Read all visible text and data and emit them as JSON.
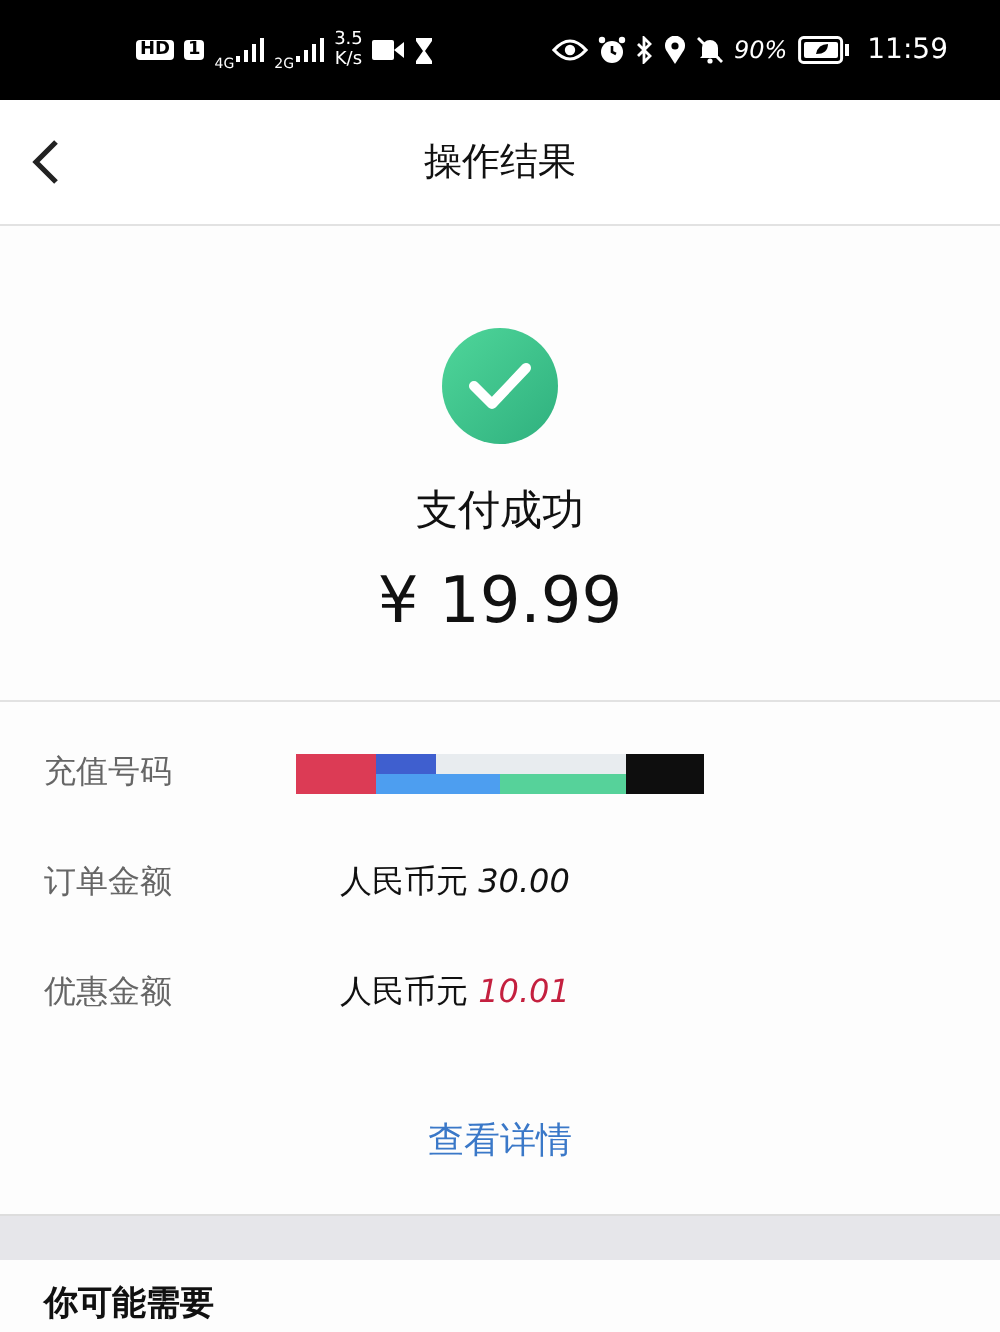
{
  "status_bar": {
    "hd": "HD",
    "sim": "1",
    "networks": [
      "4G",
      "2G"
    ],
    "speed": [
      "3.5",
      "K/s"
    ],
    "battery": "90%",
    "time": "11:59"
  },
  "nav": {
    "title": "操作结果"
  },
  "result": {
    "status": "支付成功",
    "amount": "¥ 19.99"
  },
  "details": [
    {
      "label": "充值号码",
      "kind": "picture"
    },
    {
      "label": "订单金额",
      "kind": "text",
      "currency": "人民币元",
      "value": "30.00",
      "highlight": false
    },
    {
      "label": "优惠金额",
      "kind": "text",
      "currency": "人民币元",
      "value": "10.01",
      "highlight": true
    }
  ],
  "link": "查看详情",
  "section_title": "你可能需要"
}
